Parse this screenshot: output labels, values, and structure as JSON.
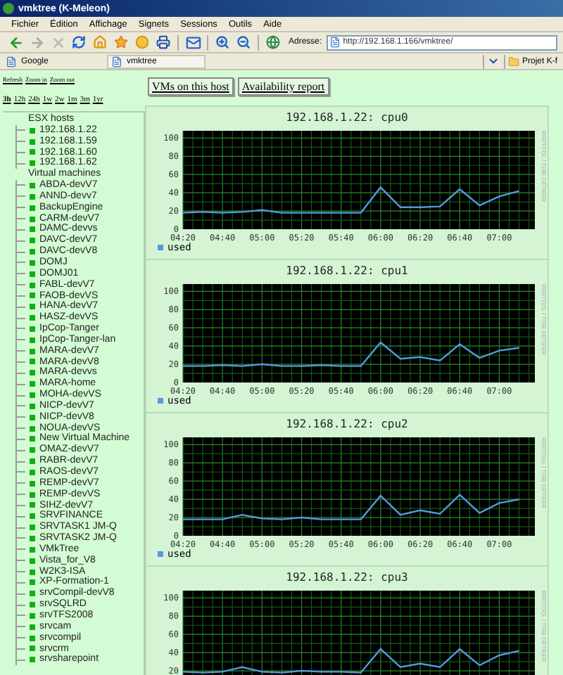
{
  "window": {
    "title": "vmktree (K-Meleon)"
  },
  "menu": [
    "Fichier",
    "Édition",
    "Affichage",
    "Signets",
    "Sessions",
    "Outils",
    "Aide"
  ],
  "address_bar": {
    "label": "Adresse:",
    "value": "http://192.168.1.166/vmktree/"
  },
  "bookmarks": [
    {
      "label": "Google"
    }
  ],
  "tabs": [
    {
      "label": "vmktree",
      "selected": true
    }
  ],
  "bookmark_folder": {
    "label": "Projet K-f"
  },
  "page": {
    "links": [
      "Refresh",
      "Zoom in",
      "Zoom out"
    ],
    "periods": [
      {
        "label": "3h",
        "selected": true
      },
      {
        "label": "12h",
        "selected": false
      },
      {
        "label": "24h",
        "selected": false
      },
      {
        "label": "1w",
        "selected": false
      },
      {
        "label": "2w",
        "selected": false
      },
      {
        "label": "1m",
        "selected": false
      },
      {
        "label": "3m",
        "selected": false
      },
      {
        "label": "1yr",
        "selected": false
      }
    ],
    "buttons": [
      "VMs on this host",
      "Availability report"
    ],
    "tree": [
      {
        "label": "ESX hosts",
        "children": [
          "192.168.1.22",
          "192.168.1.59",
          "192.168.1.60",
          "192.168.1.62"
        ]
      },
      {
        "label": "Virtual machines",
        "children": [
          "ABDA-devV7",
          "ANND-devv7",
          "BackupEngine",
          "CARM-devV7",
          "DAMC-devvs",
          "DAVC-devV7",
          "DAVC-devV8",
          "DOMJ",
          "DOMJ01",
          "FABL-devV7",
          "FAOB-devVS",
          "HANA-devV7",
          "HASZ-devVS",
          "IpCop-Tanger",
          "IpCop-Tanger-lan",
          "MARA-devV7",
          "MARA-devV8",
          "MARA-devvs",
          "MARA-home",
          "MOHA-devVS",
          "NICP-devV7",
          "NICP-devV8",
          "NOUA-devVS",
          "New Virtual Machine",
          "OMAZ-devV7",
          "RABR-devV7",
          "RAOS-devV7",
          "REMP-devV7",
          "REMP-devVS",
          "SIHZ-devV7",
          "SRVFINANCE",
          "SRVTASK1 JM-Q",
          "SRVTASK2 JM-Q",
          "VMkTree",
          "Vista_for_V8",
          "W2K3-ISA",
          "XP-Formation-1",
          "srvCompil-devV8",
          "srvSQLRD",
          "srvTFS2008",
          "srvcam",
          "srvcompil",
          "srvcrm",
          "srvsharepoint"
        ]
      }
    ],
    "charts": [
      {
        "side_label": "RRDTOOL / TOBI OETIKER",
        "chart_data": {
          "type": "line",
          "title": "192.168.1.22: cpu0",
          "grid": true,
          "categories": [
            "04:20",
            null,
            "04:40",
            null,
            "05:00",
            null,
            "05:20",
            null,
            "05:40",
            null,
            "06:00",
            null,
            "06:20",
            null,
            "06:40",
            null,
            "07:00",
            null
          ],
          "series": [
            {
              "name": "used",
              "color": "#5599dd",
              "values": [
                18,
                19,
                18,
                19,
                21,
                18,
                18,
                18,
                18,
                18,
                46,
                24,
                24,
                25,
                44,
                26,
                36,
                42
              ]
            }
          ],
          "ylim": [
            0,
            108
          ],
          "yticks": [
            0,
            20,
            40,
            60,
            80,
            100
          ]
        }
      },
      {
        "side_label": "RRDTOOL / TOBI OETIKER",
        "chart_data": {
          "type": "line",
          "title": "192.168.1.22: cpu1",
          "grid": true,
          "categories": [
            "04:20",
            null,
            "04:40",
            null,
            "05:00",
            null,
            "05:20",
            null,
            "05:40",
            null,
            "06:00",
            null,
            "06:20",
            null,
            "06:40",
            null,
            "07:00",
            null
          ],
          "series": [
            {
              "name": "used",
              "color": "#5599dd",
              "values": [
                18,
                18,
                19,
                18,
                20,
                18,
                18,
                19,
                18,
                18,
                44,
                26,
                28,
                24,
                42,
                27,
                35,
                38
              ]
            }
          ],
          "ylim": [
            0,
            108
          ],
          "yticks": [
            0,
            20,
            40,
            60,
            80,
            100
          ]
        }
      },
      {
        "side_label": "RRDTOOL / TOBI OETIKER",
        "chart_data": {
          "type": "line",
          "title": "192.168.1.22: cpu2",
          "grid": true,
          "categories": [
            "04:20",
            null,
            "04:40",
            null,
            "05:00",
            null,
            "05:20",
            null,
            "05:40",
            null,
            "06:00",
            null,
            "06:20",
            null,
            "06:40",
            null,
            "07:00",
            null
          ],
          "series": [
            {
              "name": "used",
              "color": "#5599dd",
              "values": [
                18,
                18,
                18,
                23,
                19,
                18,
                20,
                18,
                18,
                18,
                44,
                23,
                28,
                24,
                45,
                25,
                36,
                40
              ]
            }
          ],
          "ylim": [
            0,
            108
          ],
          "yticks": [
            0,
            20,
            40,
            60,
            80,
            100
          ]
        }
      },
      {
        "side_label": "RRDTOOL / TOBI OETIKER",
        "chart_data": {
          "type": "line",
          "title": "192.168.1.22: cpu3",
          "grid": true,
          "series": [
            {
              "color": "#5599dd",
              "values": [
                19,
                18,
                19,
                24,
                19,
                18,
                20,
                19,
                19,
                18,
                44,
                24,
                28,
                24,
                44,
                26,
                37,
                42
              ]
            }
          ],
          "ylim": [
            0,
            108
          ],
          "yticks": [
            20,
            40,
            60,
            80,
            100
          ]
        }
      }
    ]
  }
}
